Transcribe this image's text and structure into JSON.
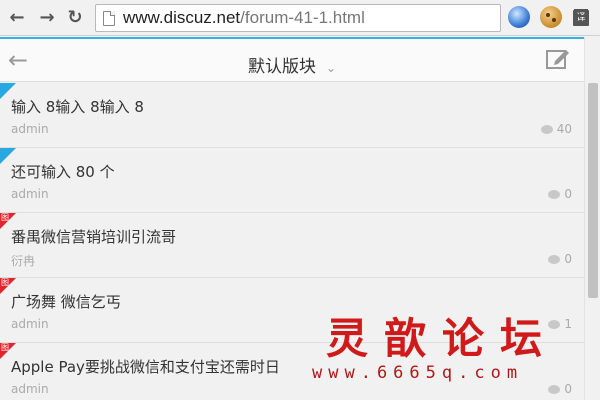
{
  "browser": {
    "back_icon": "left-arrow-icon",
    "forward_icon": "right-arrow-icon",
    "reload_icon": "reload-icon",
    "url_host": "www.discuz.net",
    "url_path": "/forum-41-1.html",
    "translate_glyph": "译"
  },
  "header": {
    "title": "默认版块",
    "accent_color": "#33b1e8"
  },
  "threads": [
    {
      "title": "输入 8输入 8输入 8",
      "author": "admin",
      "replies": "40",
      "badge": "blue",
      "badge_text": ""
    },
    {
      "title": "还可输入 80 个",
      "author": "admin",
      "replies": "0",
      "badge": "blue",
      "badge_text": ""
    },
    {
      "title": "番禺微信营销培训引流哥",
      "author": "衍冉",
      "replies": "0",
      "badge": "red",
      "badge_text": "图"
    },
    {
      "title": "广场舞 微信乞丐",
      "author": "admin",
      "replies": "1",
      "badge": "red",
      "badge_text": "图"
    },
    {
      "title": "Apple Pay要挑战微信和支付宝还需时日",
      "author": "admin",
      "replies": "0",
      "badge": "red",
      "badge_text": "图"
    }
  ],
  "watermark": {
    "chinese": "灵歆论坛",
    "url": "www.6665q.com"
  }
}
